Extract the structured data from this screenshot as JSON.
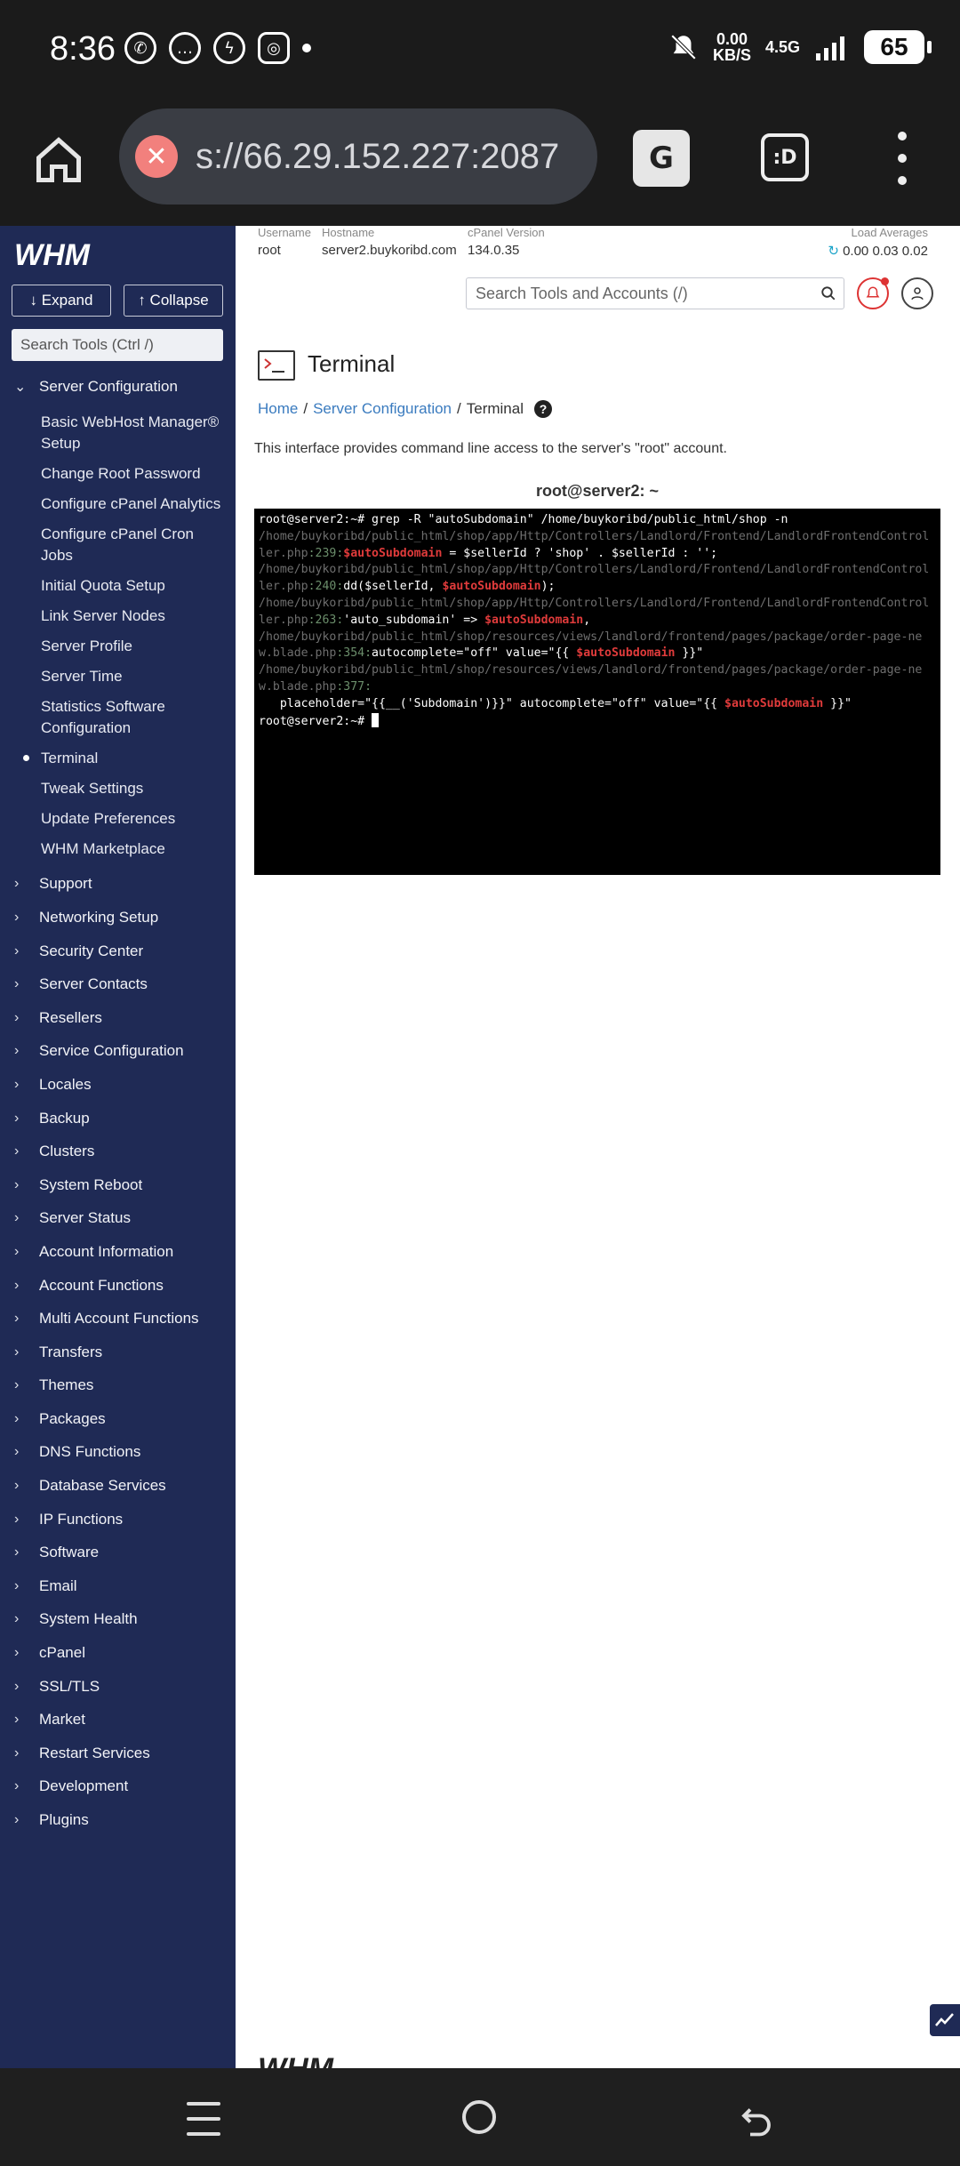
{
  "status_bar": {
    "time": "8:36",
    "speed_value": "0.00",
    "speed_unit": "KB/S",
    "network": "4.5G",
    "battery": "65"
  },
  "browser": {
    "url": "s://66.29.152.227:2087"
  },
  "sidebar": {
    "expand_label": "↓ Expand",
    "collapse_label": "↑ Collapse",
    "search_placeholder": "Search Tools (Ctrl /)",
    "section_open": "Server Configuration",
    "sub_items": [
      "Basic WebHost Manager® Setup",
      "Change Root Password",
      "Configure cPanel Analytics",
      "Configure cPanel Cron Jobs",
      "Initial Quota Setup",
      "Link Server Nodes",
      "Server Profile",
      "Server Time",
      "Statistics Software Configuration",
      "Terminal",
      "Tweak Settings",
      "Update Preferences",
      "WHM Marketplace"
    ],
    "sections": [
      "Support",
      "Networking Setup",
      "Security Center",
      "Server Contacts",
      "Resellers",
      "Service Configuration",
      "Locales",
      "Backup",
      "Clusters",
      "System Reboot",
      "Server Status",
      "Account Information",
      "Account Functions",
      "Multi Account Functions",
      "Transfers",
      "Themes",
      "Packages",
      "DNS Functions",
      "Database Services",
      "IP Functions",
      "Software",
      "Email",
      "System Health",
      "cPanel",
      "SSL/TLS",
      "Market",
      "Restart Services",
      "Development",
      "Plugins"
    ]
  },
  "topinfo": {
    "username_label": "Username",
    "username": "root",
    "hostname_label": "Hostname",
    "hostname": "server2.buykoribd.com",
    "version_label": "cPanel Version",
    "version": "134.0.35",
    "load_label": "Load Averages",
    "load": "0.00  0.03  0.02"
  },
  "header": {
    "search_placeholder": "Search Tools and Accounts (/)"
  },
  "page": {
    "title": "Terminal",
    "breadcrumb": [
      "Home",
      "Server Configuration",
      "Terminal"
    ],
    "description": "This interface provides command line access to the server's \"root\" account.",
    "terminal_header": "root@server2: ~"
  },
  "terminal": {
    "cmd": "root@server2:~# grep -R \"autoSubdomain\" /home/buykoribd/public_html/shop -n",
    "l1_path": "/home/buykoribd/public_html/shop/app/Http/Controllers/Landlord/Frontend/LandlordFrontendController.php",
    "l1_num": ":239:",
    "l1_var": "$autoSubdomain",
    "l1_rest": " = $sellerId ? 'shop' . $sellerId : '';",
    "l2_path": "/home/buykoribd/public_html/shop/app/Http/Controllers/Landlord/Frontend/LandlordFrontendController.php",
    "l2_num": ":240:",
    "l2_pre": "dd($sellerId, ",
    "l2_var": "$autoSubdomain",
    "l2_rest": ");",
    "l3_path": "/home/buykoribd/public_html/shop/app/Http/Controllers/Landlord/Frontend/LandlordFrontendController.php",
    "l3_num": ":263:",
    "l3_pre": "'auto_subdomain' => ",
    "l3_var": "$autoSubdomain",
    "l3_rest": ",",
    "l4_path": "/home/buykoribd/public_html/shop/resources/views/landlord/frontend/pages/package/order-page-new.blade.php",
    "l4_num": ":354:",
    "l4_pre": "autocomplete=\"off\" value=\"{{ ",
    "l4_var": "$autoSubdomain",
    "l4_rest": " }}\"",
    "l5_path": "/home/buykoribd/public_html/shop/resources/views/landlord/frontend/pages/package/order-page-new.blade.php",
    "l5_num": ":377:",
    "l5_pre": "\n   placeholder=\"{{__('Subdomain')}}\" autocomplete=\"off\" value=\"{{ ",
    "l5_var": "$autoSubdomain",
    "l5_rest": " }}\"",
    "prompt": "root@server2:~# "
  },
  "colors": {
    "sidebar_bg": "#1f2a55",
    "link": "#3a7bbf",
    "terminal_bg": "#000000",
    "terminal_highlight": "#e03b3b"
  }
}
